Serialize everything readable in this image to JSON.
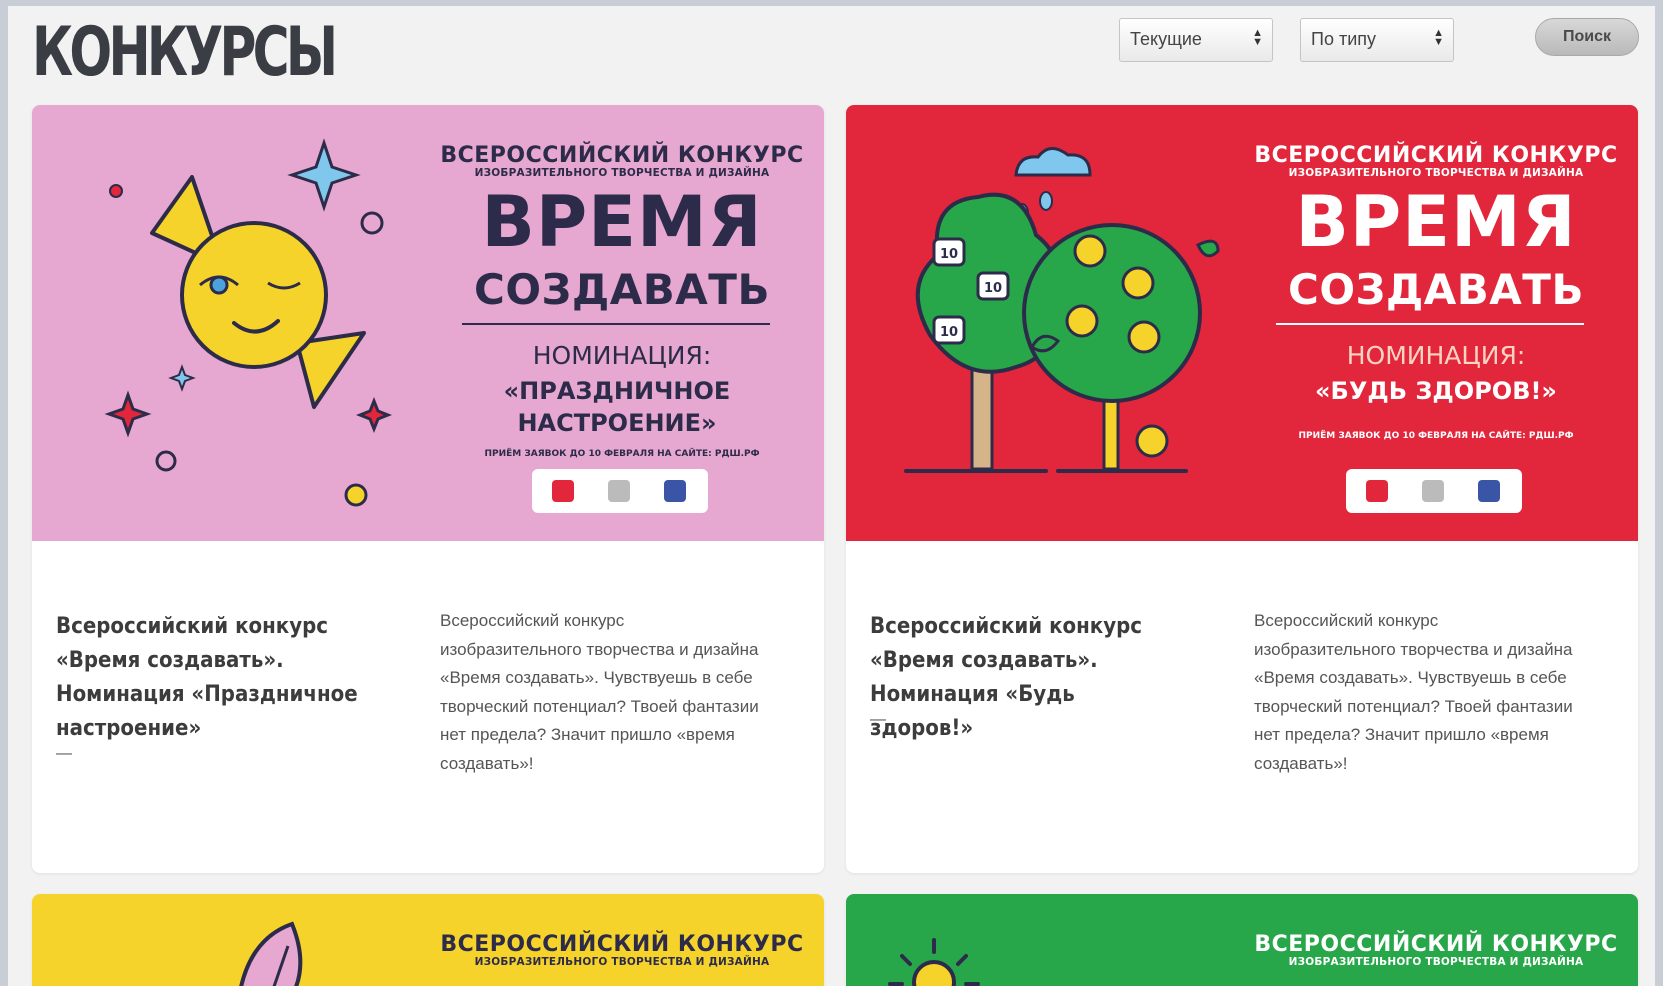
{
  "header": {
    "logo_text": "КОНКУРСЫ",
    "filter_status": "Текущие",
    "filter_type": "По типу",
    "search_label": "Поиск"
  },
  "colors": {
    "pink": "#e6a8d0",
    "red": "#e2263c",
    "yellow": "#f6d32a",
    "green": "#27a74a",
    "navy": "#2d2b4a"
  },
  "cards": [
    {
      "banner": {
        "heading": "ВСЕРОССИЙСКИЙ КОНКУРС",
        "subheading": "ИЗОБРАЗИТЕЛЬНОГО ТВОРЧЕСТВА И ДИЗАЙНА",
        "big_line1": "ВРЕМЯ",
        "big_line2": "СОЗДАВАТЬ",
        "nomination_label": "НОМИНАЦИЯ:",
        "nomination_name": "«ПРАЗДНИЧНОЕ НАСТРОЕНИЕ»",
        "deadline_prefix": "ПРИЁМ ЗАЯВОК ",
        "deadline_date": "ДО 10 ФЕВРАЛЯ",
        "deadline_mid": " НА САЙТЕ: ",
        "deadline_site": "РДШ.РФ",
        "illustration": "candy-icon"
      },
      "title": "Всероссийский конкурс «Время создавать». Номинация «Праздничное настроение»",
      "dash": "—",
      "description": "Всероссийский конкурс изобразительного творчества и дизайна «Время создавать». Чувствуешь в себе творческий потенциал? Твоей фантазии нет предела? Значит пришло «время создавать»!"
    },
    {
      "banner": {
        "heading": "ВСЕРОССИЙСКИЙ КОНКУРС",
        "subheading": "ИЗОБРАЗИТЕЛЬНОГО ТВОРЧЕСТВА И ДИЗАЙНА",
        "big_line1": "ВРЕМЯ",
        "big_line2": "СОЗДАВАТЬ",
        "nomination_label": "НОМИНАЦИЯ:",
        "nomination_name": "«БУДЬ ЗДОРОВ!»",
        "deadline_prefix": "ПРИЁМ ЗАЯВОК ",
        "deadline_date": "ДО 10 ФЕВРАЛЯ",
        "deadline_mid": " НА САЙТЕ: ",
        "deadline_site": "РДШ.РФ",
        "illustration": "trees-icon",
        "weight_label": "10"
      },
      "title": "Всероссийский конкурс «Время создавать». Номинация «Будь здоров!»",
      "dash": "—",
      "description": "Всероссийский конкурс изобразительного творчества и дизайна «Время создавать». Чувствуешь в себе творческий потенциал? Твоей фантазии нет предела? Значит пришло «время создавать»!"
    },
    {
      "banner": {
        "heading": "ВСЕРОССИЙСКИЙ КОНКУРС",
        "subheading": "ИЗОБРАЗИТЕЛЬНОГО ТВОРЧЕСТВА И ДИЗАЙНА",
        "illustration": "leaf-icon"
      }
    },
    {
      "banner": {
        "heading": "ВСЕРОССИЙСКИЙ КОНКУРС",
        "subheading": "ИЗОБРАЗИТЕЛЬНОГО ТВОРЧЕСТВА И ДИЗАЙНА",
        "illustration": "sun-icon"
      }
    }
  ]
}
